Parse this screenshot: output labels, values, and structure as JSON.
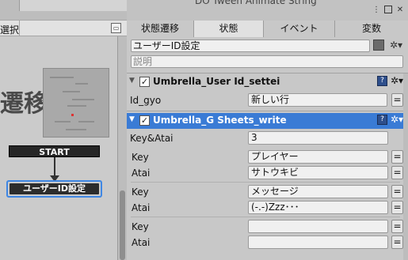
{
  "window": {
    "title_hint": "DO Tween Animate String",
    "controls": [
      "⋮",
      "□",
      "✕"
    ]
  },
  "left_panel": {
    "header_label": "選択",
    "canvas_title": "遷移",
    "start_node": "START",
    "state_node": "ユーザーID設定"
  },
  "tabs": [
    {
      "label": "状態遷移",
      "active": false
    },
    {
      "label": "状態",
      "active": true
    },
    {
      "label": "イベント",
      "active": false
    },
    {
      "label": "変数",
      "active": false
    }
  ],
  "state": {
    "name": "ユーザーID設定",
    "description_placeholder": "説明",
    "color": "#6b6b6b"
  },
  "actions": [
    {
      "title": "Umbrella_User Id_settei",
      "enabled": true,
      "selected": false,
      "fields": [
        {
          "label": "Id_gyo",
          "value": "新しい行"
        }
      ]
    },
    {
      "title": "Umbrella_G Sheets_write",
      "enabled": true,
      "selected": true,
      "key_atai_label": "Key&Atai",
      "key_atai_value": "3",
      "pairs": [
        {
          "key_label": "Key",
          "key_value": "プレイヤー",
          "atai_label": "Atai",
          "atai_value": "サトウキビ"
        },
        {
          "key_label": "Key",
          "key_value": "メッセージ",
          "atai_label": "Atai",
          "atai_value": "(-.-)Zzz･･･"
        },
        {
          "key_label": "Key",
          "key_value": "",
          "atai_label": "Atai",
          "atai_value": ""
        }
      ]
    }
  ],
  "icons": {
    "checkbox": "✓",
    "collapse": "▼",
    "help": "?",
    "gear": "✲▾",
    "equals": "="
  },
  "colors": {
    "selection": "#3a7bd5",
    "node_outline": "#3f87e4"
  }
}
